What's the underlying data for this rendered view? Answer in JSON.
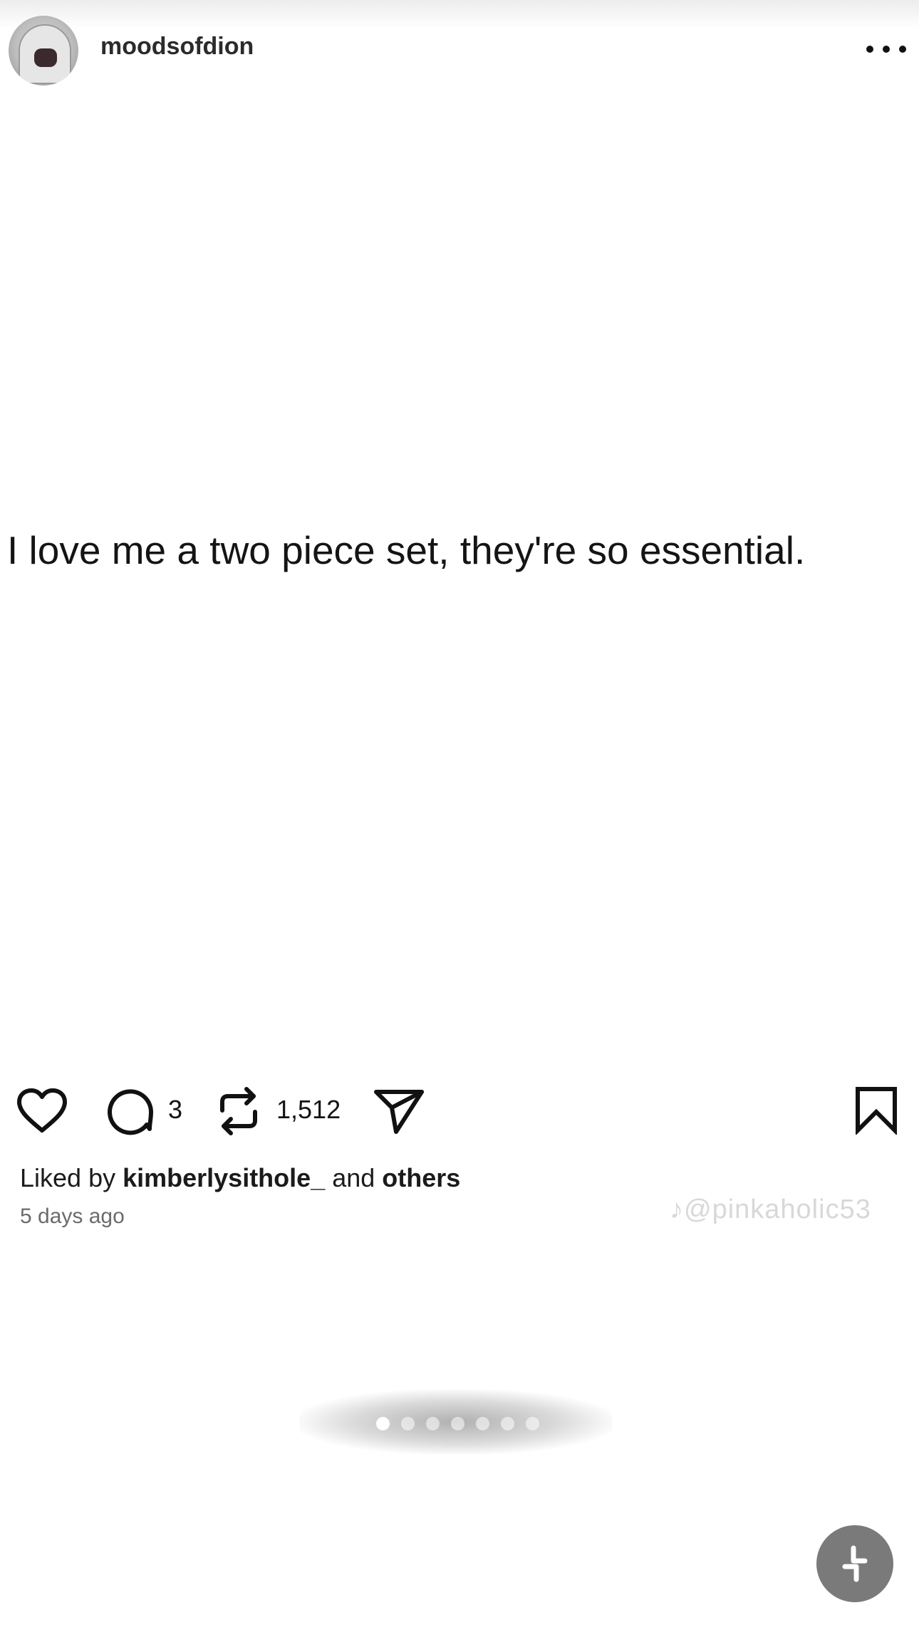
{
  "header": {
    "username": "moodsofdion",
    "avatar_icon": "avatar-image",
    "more_icon": "more-horizontal-icon"
  },
  "post": {
    "text": "I love me a two piece set, they're so essential."
  },
  "actions": {
    "comment_count": "3",
    "repost_count": "1,512",
    "icons": [
      "heart-icon",
      "comment-icon",
      "repost-icon",
      "share-icon",
      "bookmark-icon"
    ]
  },
  "meta": {
    "liked_prefix": "Liked by ",
    "liked_user": "kimberlysithole_",
    "liked_middle": " and ",
    "liked_others": "others",
    "time_ago": "5 days ago"
  },
  "watermark": {
    "text": "@pinkaholic53"
  },
  "pager": {
    "total": 7,
    "current": 1
  },
  "fab": {
    "icon": "collapse-icon"
  },
  "colors": {
    "text": "#141414",
    "secondary": "#6b6b6b",
    "fab_bg": "#7a7a7a"
  }
}
